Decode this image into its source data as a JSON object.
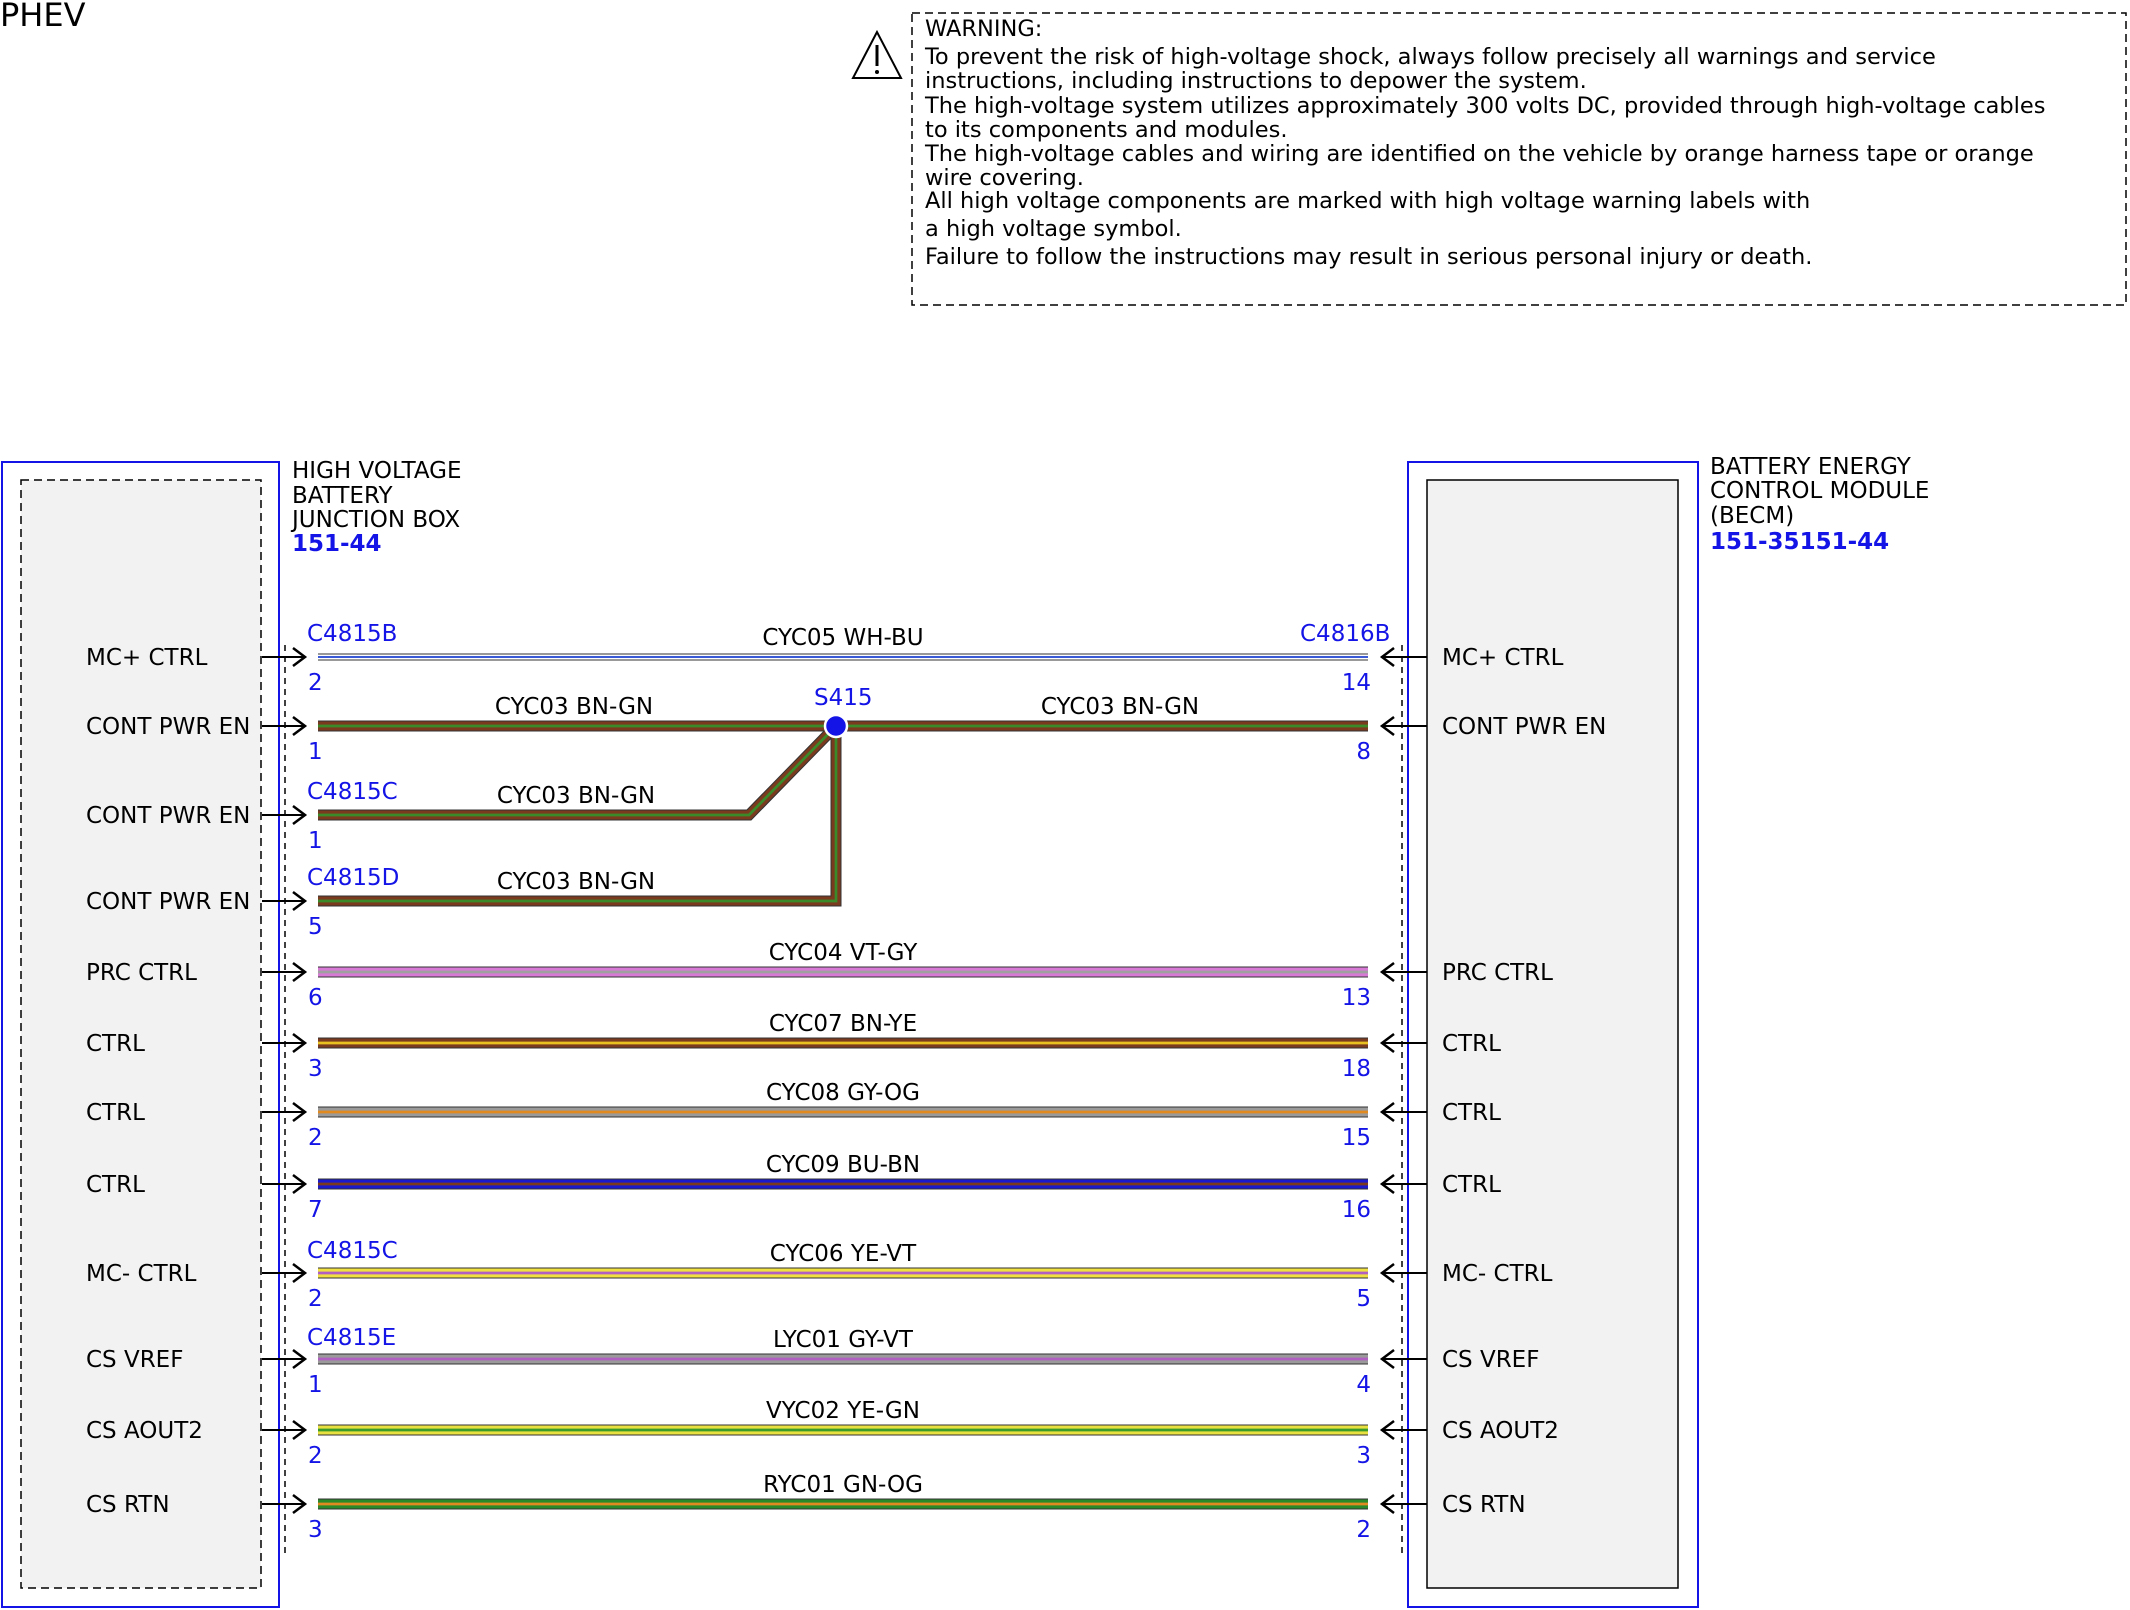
{
  "page_title": "PHEV",
  "warning": {
    "lines": [
      "WARNING:",
      "To prevent the risk of high-voltage shock, always follow precisely all warnings and service",
      "instructions, including instructions to depower the system.",
      "The high-voltage system utilizes approximately 300 volts DC, provided through high-voltage cables",
      "to its components and modules.",
      "The high-voltage cables and wiring are identified on the vehicle by orange harness tape or orange",
      "wire covering.",
      "All high voltage components are marked with high voltage warning labels with",
      "a high voltage symbol.",
      "Failure to follow the instructions may result in serious personal injury or death."
    ]
  },
  "left_module": {
    "name_lines": [
      "HIGH VOLTAGE",
      "BATTERY",
      "JUNCTION BOX"
    ],
    "ref": "151-44"
  },
  "right_module": {
    "name_lines": [
      "BATTERY ENERGY",
      "CONTROL MODULE",
      "(BECM)"
    ],
    "ref": "151-35151-44"
  },
  "splice": {
    "label": "S415"
  },
  "connectors": {
    "c4815b": "C4815B",
    "c4816b": "C4816B",
    "c4815c_a": "C4815C",
    "c4815d": "C4815D",
    "c4815c_b": "C4815C",
    "c4815e": "C4815E"
  },
  "wires": [
    {
      "circuit": "CYC05",
      "color": "WH-BU",
      "left_pin": "2",
      "left_label": "MC+ CTRL",
      "right_pin": "14",
      "right_label": "MC+ CTRL",
      "c1": "#ffffff",
      "c2": "#3b5bd6"
    },
    {
      "circuit": "CYC03",
      "color": "BN-GN",
      "circuit2": "CYC03",
      "color2": "BN-GN",
      "left_pin": "1",
      "left_label": "CONT PWR EN",
      "right_pin": "8",
      "right_label": "CONT PWR EN",
      "c1": "#7a3a1e",
      "c2": "#3a8a2a"
    },
    {
      "circuit": "CYC03",
      "color": "BN-GN",
      "left_pin": "1",
      "left_label": "CONT PWR EN",
      "c1": "#7a3a1e",
      "c2": "#3a8a2a"
    },
    {
      "circuit": "CYC03",
      "color": "BN-GN",
      "left_pin": "5",
      "left_label": "CONT PWR EN",
      "c1": "#7a3a1e",
      "c2": "#3a8a2a"
    },
    {
      "circuit": "CYC04",
      "color": "VT-GY",
      "left_pin": "6",
      "left_label": "PRC CTRL",
      "right_pin": "13",
      "right_label": "PRC CTRL",
      "c1": "#d77ad6",
      "c2": "#a0a0a0"
    },
    {
      "circuit": "CYC07",
      "color": "BN-YE",
      "left_pin": "3",
      "left_label": "CTRL",
      "right_pin": "18",
      "right_label": "CTRL",
      "c1": "#7a3a1e",
      "c2": "#e8c020"
    },
    {
      "circuit": "CYC08",
      "color": "GY-OG",
      "left_pin": "2",
      "left_label": "CTRL",
      "right_pin": "15",
      "right_label": "CTRL",
      "c1": "#9a9a9a",
      "c2": "#e08a20"
    },
    {
      "circuit": "CYC09",
      "color": "BU-BN",
      "left_pin": "7",
      "left_label": "CTRL",
      "right_pin": "16",
      "right_label": "CTRL",
      "c1": "#1a1acc",
      "c2": "#7a3a1e"
    },
    {
      "circuit": "CYC06",
      "color": "YE-VT",
      "left_pin": "2",
      "left_label": "MC- CTRL",
      "right_pin": "5",
      "right_label": "MC- CTRL",
      "c1": "#f0e040",
      "c2": "#b060c0"
    },
    {
      "circuit": "LYC01",
      "color": "GY-VT",
      "left_pin": "1",
      "left_label": "CS VREF",
      "right_pin": "4",
      "right_label": "CS VREF",
      "c1": "#9a9a9a",
      "c2": "#b060c0"
    },
    {
      "circuit": "VYC02",
      "color": "YE-GN",
      "left_pin": "2",
      "left_label": "CS AOUT2",
      "right_pin": "3",
      "right_label": "CS AOUT2",
      "c1": "#e8e040",
      "c2": "#3a9a2a"
    },
    {
      "circuit": "RYC01",
      "color": "GN-OG",
      "left_pin": "3",
      "left_label": "CS RTN",
      "right_pin": "2",
      "right_label": "CS RTN",
      "c1": "#2a8a2a",
      "c2": "#e08a20"
    }
  ]
}
